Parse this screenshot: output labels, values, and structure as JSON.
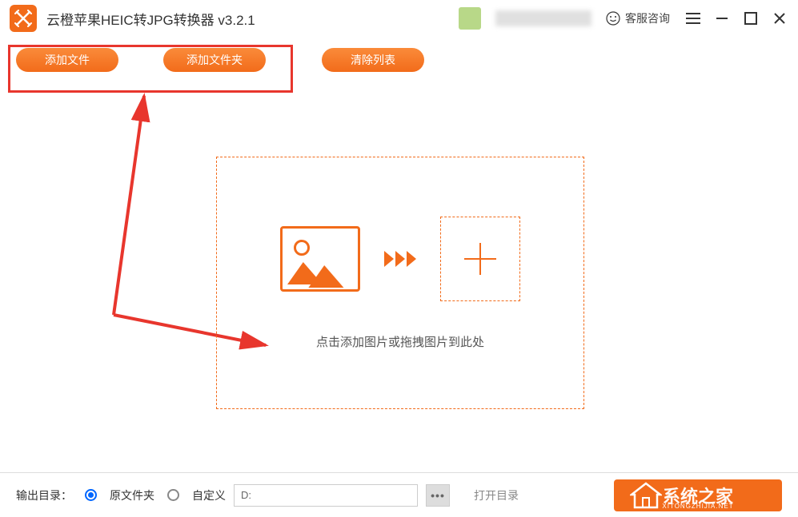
{
  "app": {
    "title": "云橙苹果HEIC转JPG转换器 v3.2.1"
  },
  "titlebar": {
    "support_label": "客服咨询"
  },
  "toolbar": {
    "add_file": "添加文件",
    "add_folder": "添加文件夹",
    "clear_list": "清除列表"
  },
  "dropzone": {
    "hint": "点击添加图片或拖拽图片到此处"
  },
  "output": {
    "label": "输出目录：",
    "option_source": "原文件夹",
    "option_custom": "自定义",
    "path_value": "D:",
    "open_dir": "打开目录"
  },
  "watermark": {
    "text": "系统之家",
    "sub": "XITONGZHIJIA.NET"
  }
}
